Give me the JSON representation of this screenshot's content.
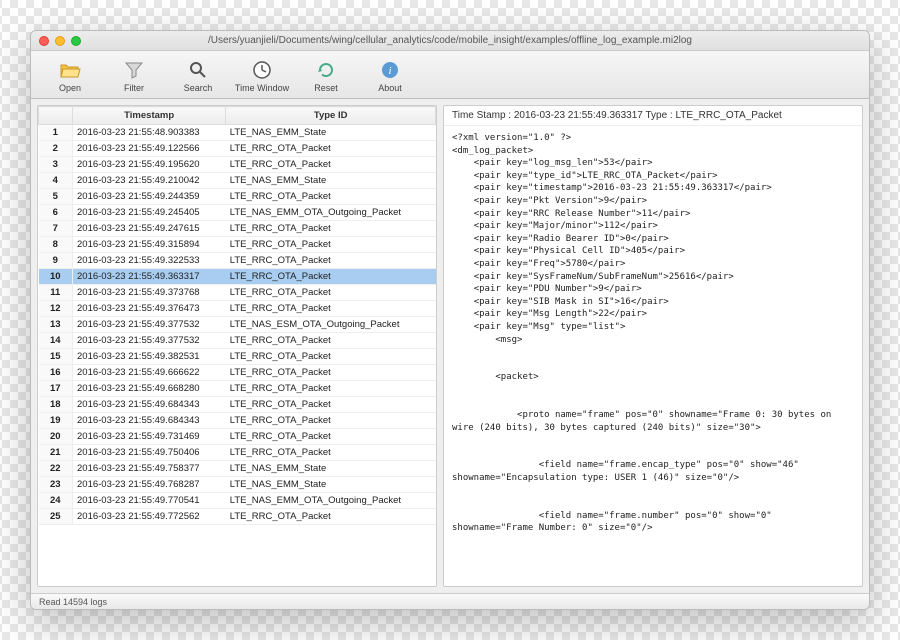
{
  "title": "/Users/yuanjieli/Documents/wing/cellular_analytics/code/mobile_insight/examples/offline_log_example.mi2log",
  "toolbar": {
    "open": "Open",
    "filter": "Filter",
    "search": "Search",
    "time_window": "Time Window",
    "reset": "Reset",
    "about": "About"
  },
  "columns": {
    "idx": "",
    "timestamp": "Timestamp",
    "type": "Type ID"
  },
  "selected_row": 10,
  "rows": [
    {
      "n": 1,
      "ts": "2016-03-23 21:55:48.903383",
      "ty": "LTE_NAS_EMM_State"
    },
    {
      "n": 2,
      "ts": "2016-03-23 21:55:49.122566",
      "ty": "LTE_RRC_OTA_Packet"
    },
    {
      "n": 3,
      "ts": "2016-03-23 21:55:49.195620",
      "ty": "LTE_RRC_OTA_Packet"
    },
    {
      "n": 4,
      "ts": "2016-03-23 21:55:49.210042",
      "ty": "LTE_NAS_EMM_State"
    },
    {
      "n": 5,
      "ts": "2016-03-23 21:55:49.244359",
      "ty": "LTE_RRC_OTA_Packet"
    },
    {
      "n": 6,
      "ts": "2016-03-23 21:55:49.245405",
      "ty": "LTE_NAS_EMM_OTA_Outgoing_Packet"
    },
    {
      "n": 7,
      "ts": "2016-03-23 21:55:49.247615",
      "ty": "LTE_RRC_OTA_Packet"
    },
    {
      "n": 8,
      "ts": "2016-03-23 21:55:49.315894",
      "ty": "LTE_RRC_OTA_Packet"
    },
    {
      "n": 9,
      "ts": "2016-03-23 21:55:49.322533",
      "ty": "LTE_RRC_OTA_Packet"
    },
    {
      "n": 10,
      "ts": "2016-03-23 21:55:49.363317",
      "ty": "LTE_RRC_OTA_Packet"
    },
    {
      "n": 11,
      "ts": "2016-03-23 21:55:49.373768",
      "ty": "LTE_RRC_OTA_Packet"
    },
    {
      "n": 12,
      "ts": "2016-03-23 21:55:49.376473",
      "ty": "LTE_RRC_OTA_Packet"
    },
    {
      "n": 13,
      "ts": "2016-03-23 21:55:49.377532",
      "ty": "LTE_NAS_ESM_OTA_Outgoing_Packet"
    },
    {
      "n": 14,
      "ts": "2016-03-23 21:55:49.377532",
      "ty": "LTE_RRC_OTA_Packet"
    },
    {
      "n": 15,
      "ts": "2016-03-23 21:55:49.382531",
      "ty": "LTE_RRC_OTA_Packet"
    },
    {
      "n": 16,
      "ts": "2016-03-23 21:55:49.666622",
      "ty": "LTE_RRC_OTA_Packet"
    },
    {
      "n": 17,
      "ts": "2016-03-23 21:55:49.668280",
      "ty": "LTE_RRC_OTA_Packet"
    },
    {
      "n": 18,
      "ts": "2016-03-23 21:55:49.684343",
      "ty": "LTE_RRC_OTA_Packet"
    },
    {
      "n": 19,
      "ts": "2016-03-23 21:55:49.684343",
      "ty": "LTE_RRC_OTA_Packet"
    },
    {
      "n": 20,
      "ts": "2016-03-23 21:55:49.731469",
      "ty": "LTE_RRC_OTA_Packet"
    },
    {
      "n": 21,
      "ts": "2016-03-23 21:55:49.750406",
      "ty": "LTE_RRC_OTA_Packet"
    },
    {
      "n": 22,
      "ts": "2016-03-23 21:55:49.758377",
      "ty": "LTE_NAS_EMM_State"
    },
    {
      "n": 23,
      "ts": "2016-03-23 21:55:49.768287",
      "ty": "LTE_NAS_EMM_State"
    },
    {
      "n": 24,
      "ts": "2016-03-23 21:55:49.770541",
      "ty": "LTE_NAS_EMM_OTA_Outgoing_Packet"
    },
    {
      "n": 25,
      "ts": "2016-03-23 21:55:49.772562",
      "ty": "LTE_RRC_OTA_Packet"
    }
  ],
  "detail": {
    "header": "Time Stamp : 2016-03-23 21:55:49.363317     Type : LTE_RRC_OTA_Packet",
    "body": "<?xml version=\"1.0\" ?>\n<dm_log_packet>\n    <pair key=\"log_msg_len\">53</pair>\n    <pair key=\"type_id\">LTE_RRC_OTA_Packet</pair>\n    <pair key=\"timestamp\">2016-03-23 21:55:49.363317</pair>\n    <pair key=\"Pkt Version\">9</pair>\n    <pair key=\"RRC Release Number\">11</pair>\n    <pair key=\"Major/minor\">112</pair>\n    <pair key=\"Radio Bearer ID\">0</pair>\n    <pair key=\"Physical Cell ID\">405</pair>\n    <pair key=\"Freq\">5780</pair>\n    <pair key=\"SysFrameNum/SubFrameNum\">25616</pair>\n    <pair key=\"PDU Number\">9</pair>\n    <pair key=\"SIB Mask in SI\">16</pair>\n    <pair key=\"Msg Length\">22</pair>\n    <pair key=\"Msg\" type=\"list\">\n        <msg>\n\n\n        <packet>\n\n\n            <proto name=\"frame\" pos=\"0\" showname=\"Frame 0: 30 bytes on wire (240 bits), 30 bytes captured (240 bits)\" size=\"30\">\n\n\n                <field name=\"frame.encap_type\" pos=\"0\" show=\"46\" showname=\"Encapsulation type: USER 1 (46)\" size=\"0\"/>\n\n\n                <field name=\"frame.number\" pos=\"0\" show=\"0\" showname=\"Frame Number: 0\" size=\"0\"/>"
  },
  "status": "Read 14594 logs"
}
